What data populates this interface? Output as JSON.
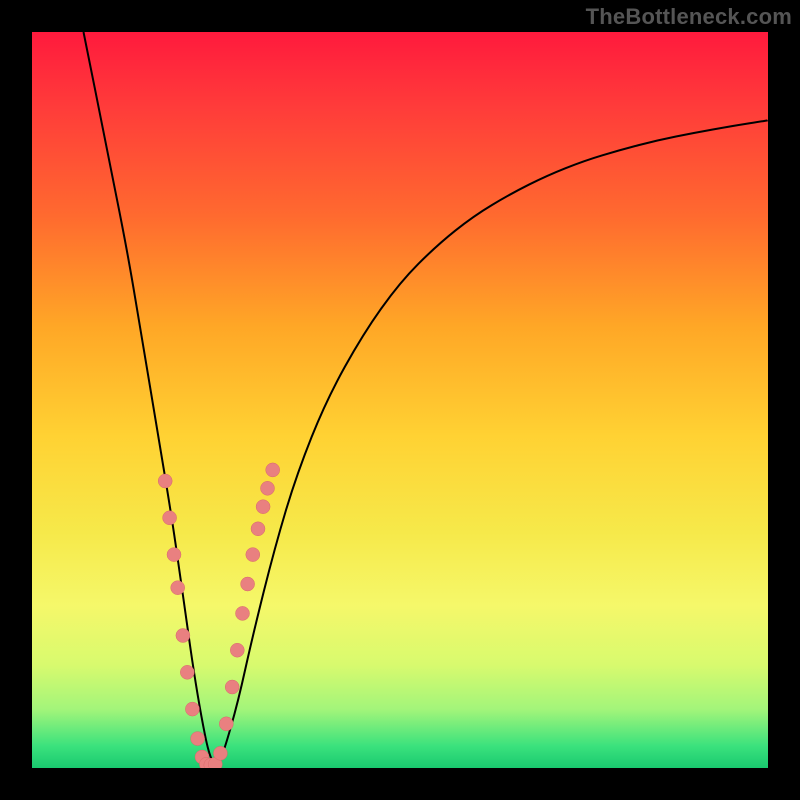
{
  "watermark": "TheBottleneck.com",
  "chart_data": {
    "type": "line",
    "title": "",
    "xlabel": "",
    "ylabel": "",
    "xlim": [
      0,
      100
    ],
    "ylim": [
      0,
      100
    ],
    "grid": false,
    "legend": false,
    "series": [
      {
        "name": "bottleneck-curve",
        "x": [
          7,
          10,
          13,
          15,
          17,
          19,
          20,
          21,
          22,
          23,
          24,
          25,
          26,
          28,
          30,
          33,
          36,
          40,
          45,
          50,
          55,
          60,
          65,
          70,
          75,
          80,
          85,
          90,
          95,
          100
        ],
        "y": [
          100,
          85,
          70,
          58,
          46,
          34,
          27,
          20,
          13,
          7,
          2,
          0,
          2,
          9,
          18,
          30,
          40,
          50,
          59,
          66,
          71,
          75,
          78,
          80.5,
          82.5,
          84,
          85.3,
          86.3,
          87.2,
          88
        ]
      }
    ],
    "markers": {
      "name": "highlight-dots",
      "x": [
        18.1,
        18.7,
        19.3,
        19.8,
        20.5,
        21.1,
        21.8,
        22.5,
        23.1,
        23.7,
        24.3,
        24.9,
        25.6,
        26.4,
        27.2,
        27.9,
        28.6,
        29.3,
        30.0,
        30.7,
        31.4,
        32.0,
        32.7
      ],
      "y": [
        39.0,
        34.0,
        29.0,
        24.5,
        18.0,
        13.0,
        8.0,
        4.0,
        1.5,
        0.5,
        0.4,
        0.5,
        2.0,
        6.0,
        11.0,
        16.0,
        21.0,
        25.0,
        29.0,
        32.5,
        35.5,
        38.0,
        40.5
      ]
    },
    "background_gradient": {
      "top": "#ff1a3d",
      "mid": "#f6e94a",
      "bottom": "#19c96f"
    }
  }
}
